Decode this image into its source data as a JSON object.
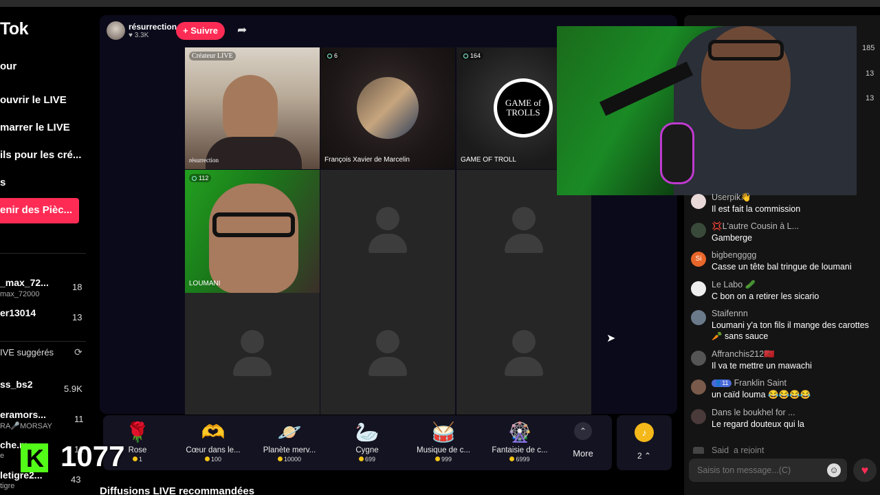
{
  "sidebar": {
    "logo": "Tok",
    "nav": [
      "our",
      "ouvrir le LIVE",
      "marrer le LIVE",
      "ils pour les cré...",
      "s"
    ],
    "coins_button": "enir des Pièc...",
    "followed": [
      {
        "name": "_max_72...",
        "sub": "max_72000",
        "count": "18"
      },
      {
        "name": "er13014",
        "sub": "",
        "count": "13"
      }
    ],
    "suggested_title": "IVE suggérés",
    "suggested": [
      {
        "name": "ss_bs2",
        "sub": "",
        "count": "5.9K"
      },
      {
        "name": "eramors...",
        "sub": "RA🎤MORSAY",
        "count": "11"
      },
      {
        "name": "che.m...",
        "sub": "e",
        "count": "11"
      },
      {
        "name": "letigre2...",
        "sub": "tigre",
        "count": "43"
      }
    ]
  },
  "host": {
    "name": "résurrection",
    "likes": "3.3K",
    "follow_label": "+ Suivre"
  },
  "grid": [
    {
      "badge": "Créateur LIVE",
      "name": "résurrection",
      "kind": "video"
    },
    {
      "badge": "6",
      "name": "François Xavier de Marcelin",
      "kind": "video"
    },
    {
      "badge": "164",
      "name": "GAME OF TROLL",
      "kind": "logo",
      "logo_text": "GAME of TROLLS"
    },
    {
      "badge": "112",
      "name": "LOUMANI",
      "kind": "video"
    },
    {
      "badge": "",
      "name": "",
      "kind": "empty"
    },
    {
      "badge": "",
      "name": "",
      "kind": "empty"
    },
    {
      "badge": "",
      "name": "",
      "kind": "empty"
    },
    {
      "badge": "",
      "name": "",
      "kind": "empty"
    },
    {
      "badge": "",
      "name": "",
      "kind": "empty"
    }
  ],
  "gifts": [
    {
      "icon": "🌹",
      "name": "Rose",
      "price": "1"
    },
    {
      "icon": "🫶",
      "name": "Cœur dans le...",
      "price": "100"
    },
    {
      "icon": "🪐",
      "name": "Planète merv...",
      "price": "10000"
    },
    {
      "icon": "🦢",
      "name": "Cygne",
      "price": "699"
    },
    {
      "icon": "🥁",
      "name": "Musique de c...",
      "price": "999"
    },
    {
      "icon": "🎡",
      "name": "Fantaisie de c...",
      "price": "6999"
    }
  ],
  "more_label": "More",
  "wallet_count": "2",
  "recommended": "Diffusions LIVE recommandées",
  "overlay": {
    "kick_letter": "K",
    "count": "1077"
  },
  "chat": {
    "side_numbers": [
      "185",
      "13",
      "13"
    ],
    "messages": [
      {
        "user": "Userpik👋",
        "text": "Il est fait la commission",
        "avatar": ""
      },
      {
        "user": "💢L'autre Cousin à L...",
        "text": "Gamberge",
        "avatar": ""
      },
      {
        "user": "bigbengggg",
        "text": "Casse un tête bal tringue de loumani",
        "avatar": "Si"
      },
      {
        "user": "Le Labo 🥒",
        "text": "C bon on a retirer les sicario",
        "avatar": ""
      },
      {
        "user": "Staifennn",
        "text": "Loumani y'a ton fils il mange des carottes 🥕 sans sauce",
        "avatar": ""
      },
      {
        "user": "Affranchis212🇲🇦",
        "text": "Il va te mettre un mawachi",
        "avatar": ""
      },
      {
        "user": "Franklin Saint",
        "level": "11",
        "text": "un caïd louma 😂😂😂😂",
        "avatar": ""
      },
      {
        "user": "Dans le boukhel for ...",
        "text": "Le regard douteux qui la",
        "avatar": ""
      },
      {
        "user": "Said_a rejoint",
        "text": "",
        "avatar": ""
      }
    ],
    "input_placeholder": "Saisis ton message...(C)"
  }
}
